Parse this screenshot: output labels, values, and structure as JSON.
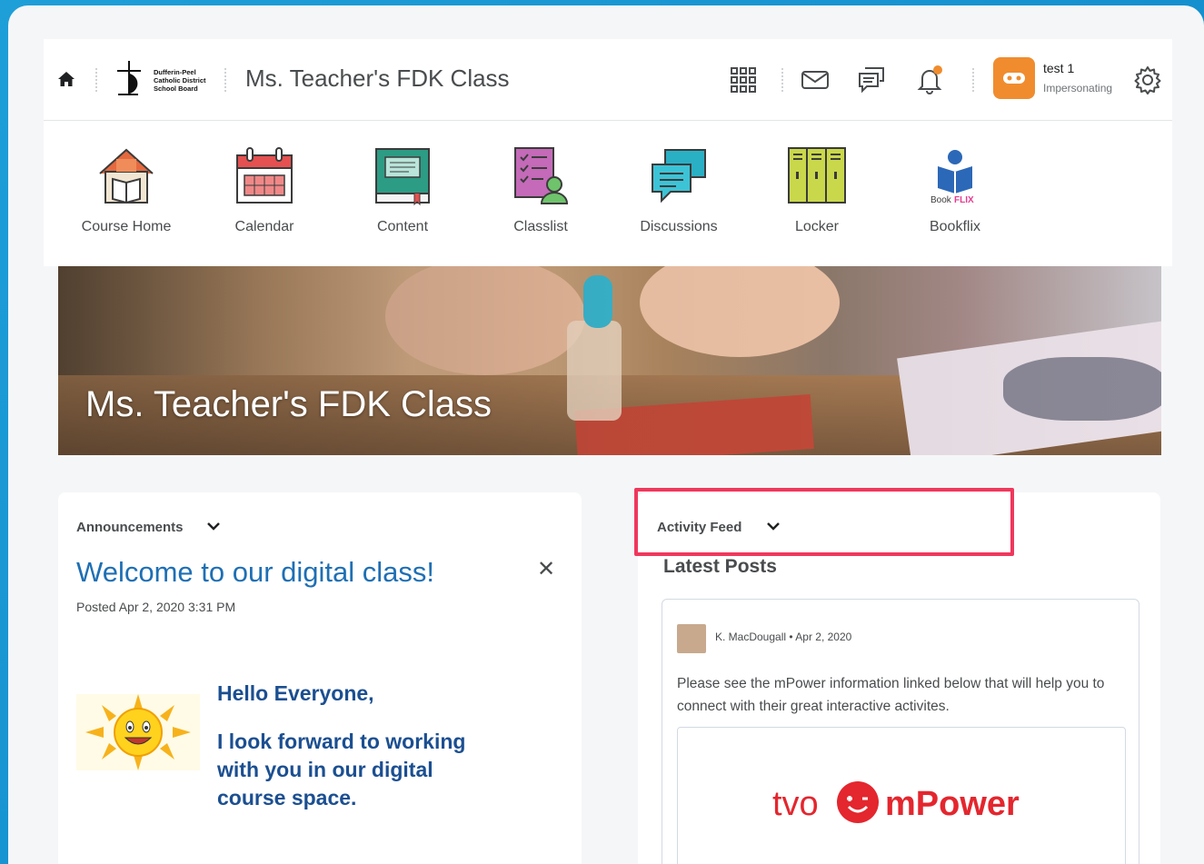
{
  "topbar": {
    "logo_text": [
      "Dufferin-Peel",
      "Catholic District",
      "School Board"
    ],
    "course_title": "Ms. Teacher's FDK Class",
    "user_name": "test 1",
    "user_status": "Impersonating",
    "accent": "#f08c2e"
  },
  "nav": {
    "items": [
      {
        "label": "Course Home",
        "icon": "house-icon"
      },
      {
        "label": "Calendar",
        "icon": "calendar-icon"
      },
      {
        "label": "Content",
        "icon": "book-icon"
      },
      {
        "label": "Classlist",
        "icon": "classlist-icon"
      },
      {
        "label": "Discussions",
        "icon": "discussions-icon"
      },
      {
        "label": "Locker",
        "icon": "locker-icon"
      },
      {
        "label": "Bookflix",
        "icon": "bookflix-icon"
      }
    ]
  },
  "banner": {
    "title": "Ms. Teacher's FDK Class"
  },
  "announcements": {
    "widget_title": "Announcements",
    "title": "Welcome to our digital class!",
    "posted": "Posted Apr 2, 2020 3:31 PM",
    "greeting": "Hello Everyone,",
    "body": "I look forward to working with you in our digital course space."
  },
  "activity": {
    "widget_title": "Activity Feed",
    "section_title": "Latest Posts",
    "post": {
      "author": "K. MacDougall",
      "date": "Apr 2, 2020",
      "text": "Please see the mPower information linked below that will help you to connect with their great interactive activites.",
      "embed_brand_left": "tvo",
      "embed_brand_right": "mPower"
    },
    "highlight_color": "#f0375c"
  }
}
